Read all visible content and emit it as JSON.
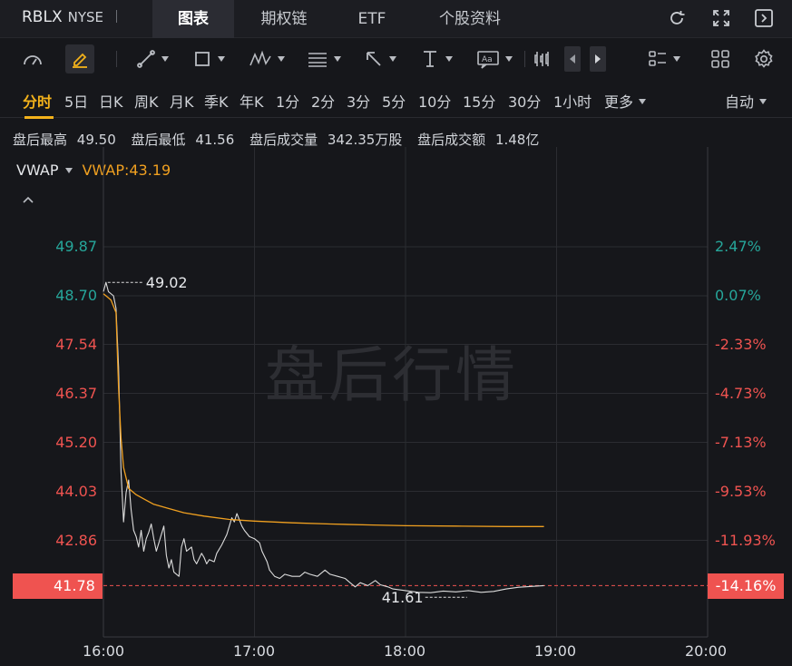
{
  "header": {
    "symbol": "RBLX",
    "exchange": "NYSE",
    "tabs": [
      {
        "label": "图表",
        "active": true
      },
      {
        "label": "期权链",
        "active": false
      },
      {
        "label": "ETF",
        "active": false
      },
      {
        "label": "个股资料",
        "active": false
      }
    ],
    "icons": [
      "refresh-icon",
      "fullscreen-icon",
      "panel-toggle-icon"
    ]
  },
  "toolbar": {
    "icons": [
      "gauge-icon",
      "draw-pencil-icon",
      "trend-line-icon",
      "rectangle-icon",
      "pattern-icon",
      "fib-icon",
      "arrow-icon",
      "measure-icon",
      "text-note-icon",
      "candle-type-icon",
      "prev-icon",
      "next-icon",
      "layout-list-icon",
      "grid-layout-icon",
      "settings-icon"
    ]
  },
  "periods": {
    "items": [
      "分时",
      "5日",
      "日K",
      "周K",
      "月K",
      "季K",
      "年K",
      "1分",
      "2分",
      "3分",
      "5分",
      "10分",
      "15分",
      "30分",
      "1小时",
      "更多"
    ],
    "active": "分时",
    "scale_mode": "自动"
  },
  "stats": {
    "items": [
      {
        "label": "盘后最高",
        "value": "49.50"
      },
      {
        "label": "盘后最低",
        "value": "41.56"
      },
      {
        "label": "盘后成交量",
        "value": "342.35万股"
      },
      {
        "label": "盘后成交额",
        "value": "1.48亿"
      }
    ]
  },
  "indicator": {
    "name": "VWAP",
    "value_label": "VWAP:43.19"
  },
  "watermark": "盘后行情",
  "chart_data": {
    "type": "line",
    "x_labels": [
      "16:00",
      "17:00",
      "18:00",
      "19:00",
      "20:00"
    ],
    "y_left_ticks": [
      "49.87",
      "48.70",
      "47.54",
      "46.37",
      "45.20",
      "44.03",
      "42.86"
    ],
    "y_right_ticks": [
      "2.47%",
      "0.07%",
      "-2.33%",
      "-4.73%",
      "-7.13%",
      "-9.53%",
      "-11.93%"
    ],
    "ylim": [
      40.6,
      51.0
    ],
    "xlim": [
      "16:00",
      "20:00"
    ],
    "reference_price": 48.67,
    "current_price": "41.78",
    "current_change": "-14.16%",
    "high_annotation": "49.02",
    "low_annotation": "41.61",
    "colors": {
      "up": "#26a69a",
      "down": "#ef5350",
      "price_line": "#dcdcdc",
      "vwap_line": "#f0a020",
      "accent": "#f3b21b"
    },
    "series": [
      {
        "name": "price",
        "points": [
          [
            "16:00",
            48.8
          ],
          [
            "16:01",
            49.02
          ],
          [
            "16:02",
            48.8
          ],
          [
            "16:04",
            48.7
          ],
          [
            "16:05",
            48.4
          ],
          [
            "16:06",
            47.0
          ],
          [
            "16:07",
            44.5
          ],
          [
            "16:08",
            43.3
          ],
          [
            "16:09",
            44.0
          ],
          [
            "16:10",
            44.3
          ],
          [
            "16:11",
            43.6
          ],
          [
            "16:12",
            43.1
          ],
          [
            "16:13",
            42.95
          ],
          [
            "16:14",
            42.7
          ],
          [
            "16:15",
            43.1
          ],
          [
            "16:16",
            42.6
          ],
          [
            "16:17",
            42.9
          ],
          [
            "16:18",
            43.05
          ],
          [
            "16:19",
            43.25
          ],
          [
            "16:20",
            42.9
          ],
          [
            "16:21",
            42.6
          ],
          [
            "16:22",
            42.8
          ],
          [
            "16:24",
            43.2
          ],
          [
            "16:25",
            42.5
          ],
          [
            "16:26",
            42.2
          ],
          [
            "16:27",
            42.4
          ],
          [
            "16:28",
            42.1
          ],
          [
            "16:30",
            42.0
          ],
          [
            "16:31",
            42.7
          ],
          [
            "16:32",
            42.9
          ],
          [
            "16:33",
            42.6
          ],
          [
            "16:35",
            42.7
          ],
          [
            "16:36",
            42.4
          ],
          [
            "16:37",
            42.3
          ],
          [
            "16:39",
            42.55
          ],
          [
            "16:40",
            42.45
          ],
          [
            "16:41",
            42.3
          ],
          [
            "16:42",
            42.4
          ],
          [
            "16:44",
            42.35
          ],
          [
            "16:45",
            42.55
          ],
          [
            "16:47",
            42.75
          ],
          [
            "16:49",
            43.0
          ],
          [
            "16:50",
            43.2
          ],
          [
            "16:51",
            43.4
          ],
          [
            "16:52",
            43.3
          ],
          [
            "16:53",
            43.5
          ],
          [
            "16:55",
            43.2
          ],
          [
            "16:56",
            43.1
          ],
          [
            "16:58",
            42.95
          ],
          [
            "17:00",
            42.9
          ],
          [
            "17:02",
            42.8
          ],
          [
            "17:03",
            42.6
          ],
          [
            "17:05",
            42.35
          ],
          [
            "17:06",
            42.15
          ],
          [
            "17:08",
            42.0
          ],
          [
            "17:10",
            41.95
          ],
          [
            "17:12",
            42.05
          ],
          [
            "17:15",
            42.0
          ],
          [
            "17:18",
            42.0
          ],
          [
            "17:20",
            42.1
          ],
          [
            "17:22",
            42.05
          ],
          [
            "17:25",
            42.0
          ],
          [
            "17:28",
            42.15
          ],
          [
            "17:30",
            42.05
          ],
          [
            "17:33",
            42.0
          ],
          [
            "17:36",
            41.95
          ],
          [
            "17:38",
            41.85
          ],
          [
            "17:40",
            41.75
          ],
          [
            "17:42",
            41.85
          ],
          [
            "17:45",
            41.78
          ],
          [
            "17:48",
            41.9
          ],
          [
            "17:50",
            41.8
          ],
          [
            "17:53",
            41.75
          ],
          [
            "17:55",
            41.7
          ],
          [
            "18:00",
            41.66
          ],
          [
            "18:05",
            41.62
          ],
          [
            "18:10",
            41.61
          ],
          [
            "18:15",
            41.65
          ],
          [
            "18:20",
            41.63
          ],
          [
            "18:25",
            41.66
          ],
          [
            "18:30",
            41.62
          ],
          [
            "18:35",
            41.64
          ],
          [
            "18:40",
            41.7
          ],
          [
            "18:45",
            41.74
          ],
          [
            "18:50",
            41.76
          ],
          [
            "18:55",
            41.78
          ]
        ]
      },
      {
        "name": "VWAP",
        "points": [
          [
            "16:00",
            48.75
          ],
          [
            "16:01",
            48.7
          ],
          [
            "16:03",
            48.6
          ],
          [
            "16:05",
            48.3
          ],
          [
            "16:06",
            46.5
          ],
          [
            "16:07",
            45.3
          ],
          [
            "16:08",
            44.6
          ],
          [
            "16:10",
            44.1
          ],
          [
            "16:13",
            43.95
          ],
          [
            "16:16",
            43.85
          ],
          [
            "16:20",
            43.72
          ],
          [
            "16:26",
            43.62
          ],
          [
            "16:32",
            43.52
          ],
          [
            "16:40",
            43.44
          ],
          [
            "16:50",
            43.36
          ],
          [
            "17:00",
            43.32
          ],
          [
            "17:15",
            43.28
          ],
          [
            "17:30",
            43.25
          ],
          [
            "17:45",
            43.23
          ],
          [
            "18:00",
            43.21
          ],
          [
            "18:20",
            43.2
          ],
          [
            "18:40",
            43.19
          ],
          [
            "18:55",
            43.19
          ]
        ]
      }
    ]
  }
}
